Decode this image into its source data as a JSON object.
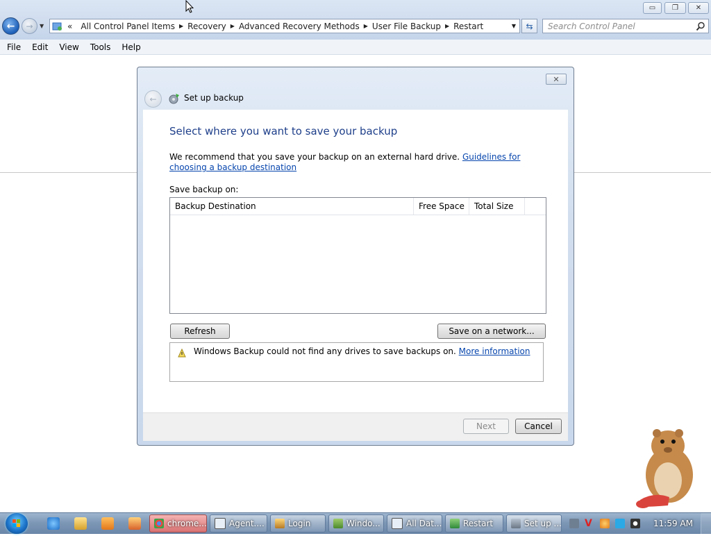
{
  "window": {
    "minimize_glyph": "▭",
    "maximize_glyph": "❐",
    "close_glyph": "✕"
  },
  "nav": {
    "back_glyph": "←",
    "forward_glyph": "→",
    "dropdown_glyph": "▼"
  },
  "address": {
    "overflow": "«",
    "crumbs": [
      "All Control Panel Items",
      "Recovery",
      "Advanced Recovery Methods",
      "User File Backup",
      "Restart"
    ],
    "separator": "▶",
    "dropdown_glyph": "▼",
    "refresh_glyph": "⇆"
  },
  "search": {
    "placeholder": "Search Control Panel"
  },
  "menu": {
    "items": [
      "File",
      "Edit",
      "View",
      "Tools",
      "Help"
    ]
  },
  "dialog": {
    "title": "Set up backup",
    "close_glyph": "✕",
    "heading": "Select where you want to save your backup",
    "description": "We recommend that you save your backup on an external hard drive.",
    "guidelines_link": "Guidelines for choosing a backup destination",
    "save_on_label": "Save backup on:",
    "columns": [
      "Backup Destination",
      "Free Space",
      "Total Size"
    ],
    "refresh_button": "Refresh",
    "network_button": "Save on a network...",
    "info_message": "Windows Backup could not find any drives to save backups on.",
    "info_link": "More information",
    "next_button": "Next",
    "cancel_button": "Cancel"
  },
  "taskbar": {
    "items": [
      "chrome...",
      "Agent....",
      "Login",
      "Windo...",
      "All Dat...",
      "Restart",
      "Set up ..."
    ],
    "clock": "11:59 AM"
  },
  "colors": {
    "accent": "#1e3f8a",
    "link": "#0645ad",
    "taskbar": "#7d97b6"
  },
  "icons": [
    "back-arrow-icon",
    "forward-arrow-icon",
    "control-panel-icon",
    "search-icon",
    "backup-icon",
    "warning-icon",
    "windows-start-icon",
    "ie-icon",
    "explorer-icon",
    "media-player-icon",
    "chrome-icon",
    "clock-tray-icons"
  ]
}
